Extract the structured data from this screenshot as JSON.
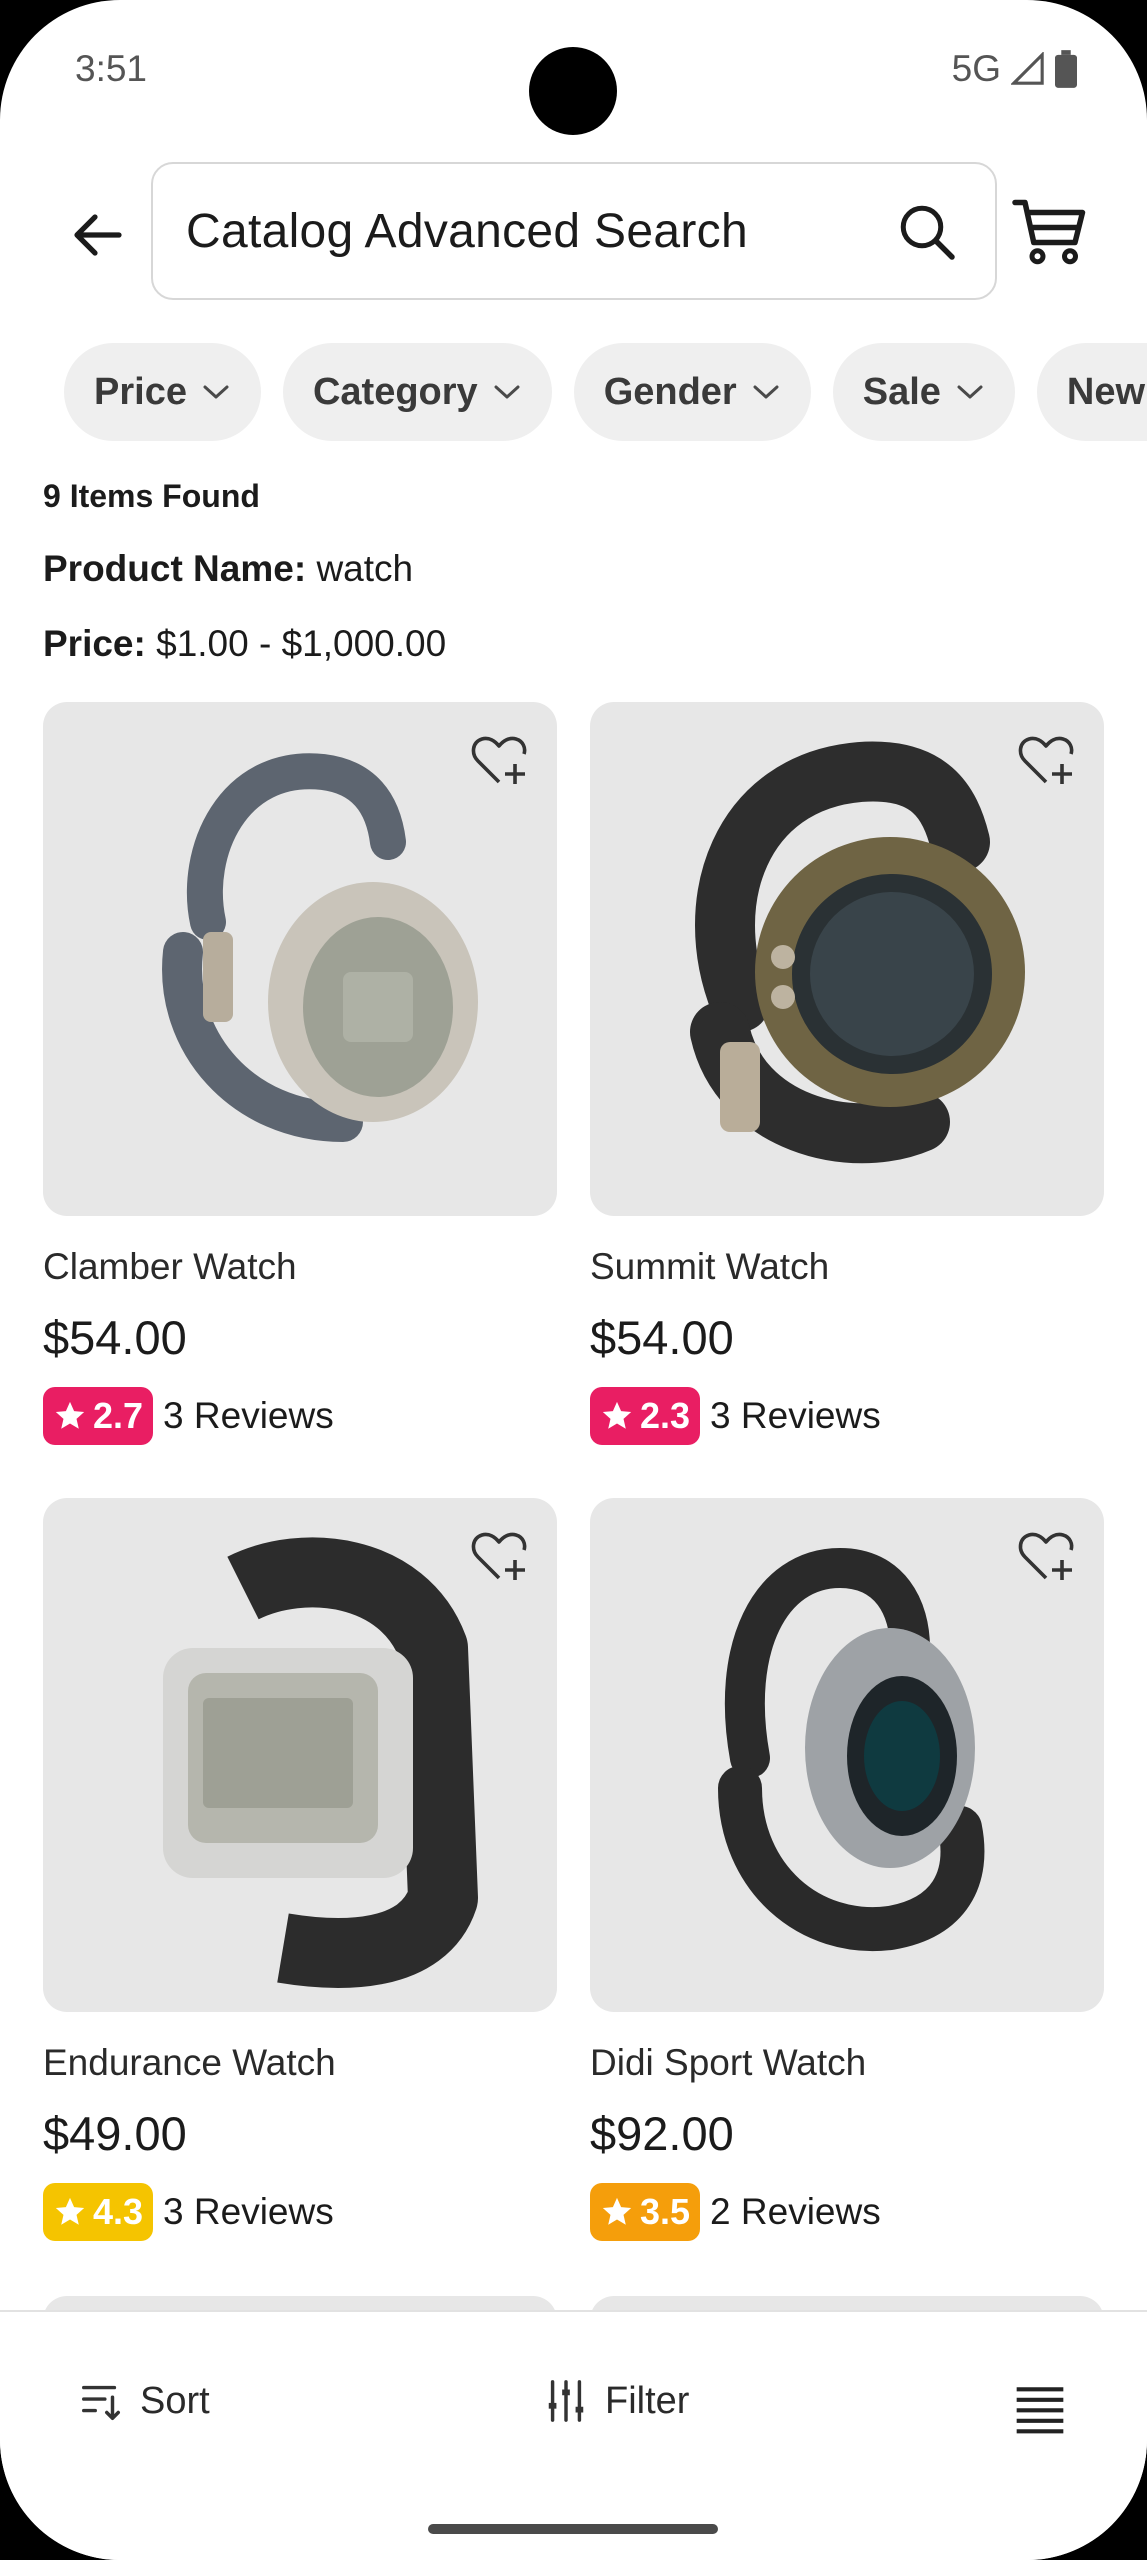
{
  "status_bar": {
    "time": "3:51",
    "network": "5G"
  },
  "header": {
    "back_icon": "arrow-left-icon",
    "search_text": "Catalog Advanced Search",
    "search_icon": "search-icon",
    "cart_icon": "cart-icon"
  },
  "filters": {
    "chips": [
      {
        "label": "Price"
      },
      {
        "label": "Category"
      },
      {
        "label": "Gender"
      },
      {
        "label": "Sale"
      },
      {
        "label": "New"
      }
    ]
  },
  "results": {
    "count_label": "9 Items Found",
    "criteria": [
      {
        "key": "Product Name:",
        "value": "watch"
      },
      {
        "key": "Price:",
        "value": "$1.00 - $1,000.00"
      }
    ]
  },
  "products": [
    {
      "name": "Clamber Watch",
      "price": "$54.00",
      "rating": "2.7",
      "reviews": "3 Reviews",
      "badge_color": "#e91e63"
    },
    {
      "name": "Summit Watch",
      "price": "$54.00",
      "rating": "2.3",
      "reviews": "3 Reviews",
      "badge_color": "#e91e63"
    },
    {
      "name": "Endurance Watch",
      "price": "$49.00",
      "rating": "4.3",
      "reviews": "3 Reviews",
      "badge_color": "#f5c400"
    },
    {
      "name": "Didi Sport Watch",
      "price": "$92.00",
      "rating": "3.5",
      "reviews": "2 Reviews",
      "badge_color": "#f59e0b"
    }
  ],
  "bottom_bar": {
    "sort_label": "Sort",
    "filter_label": "Filter",
    "view_icon": "list-view-icon"
  }
}
